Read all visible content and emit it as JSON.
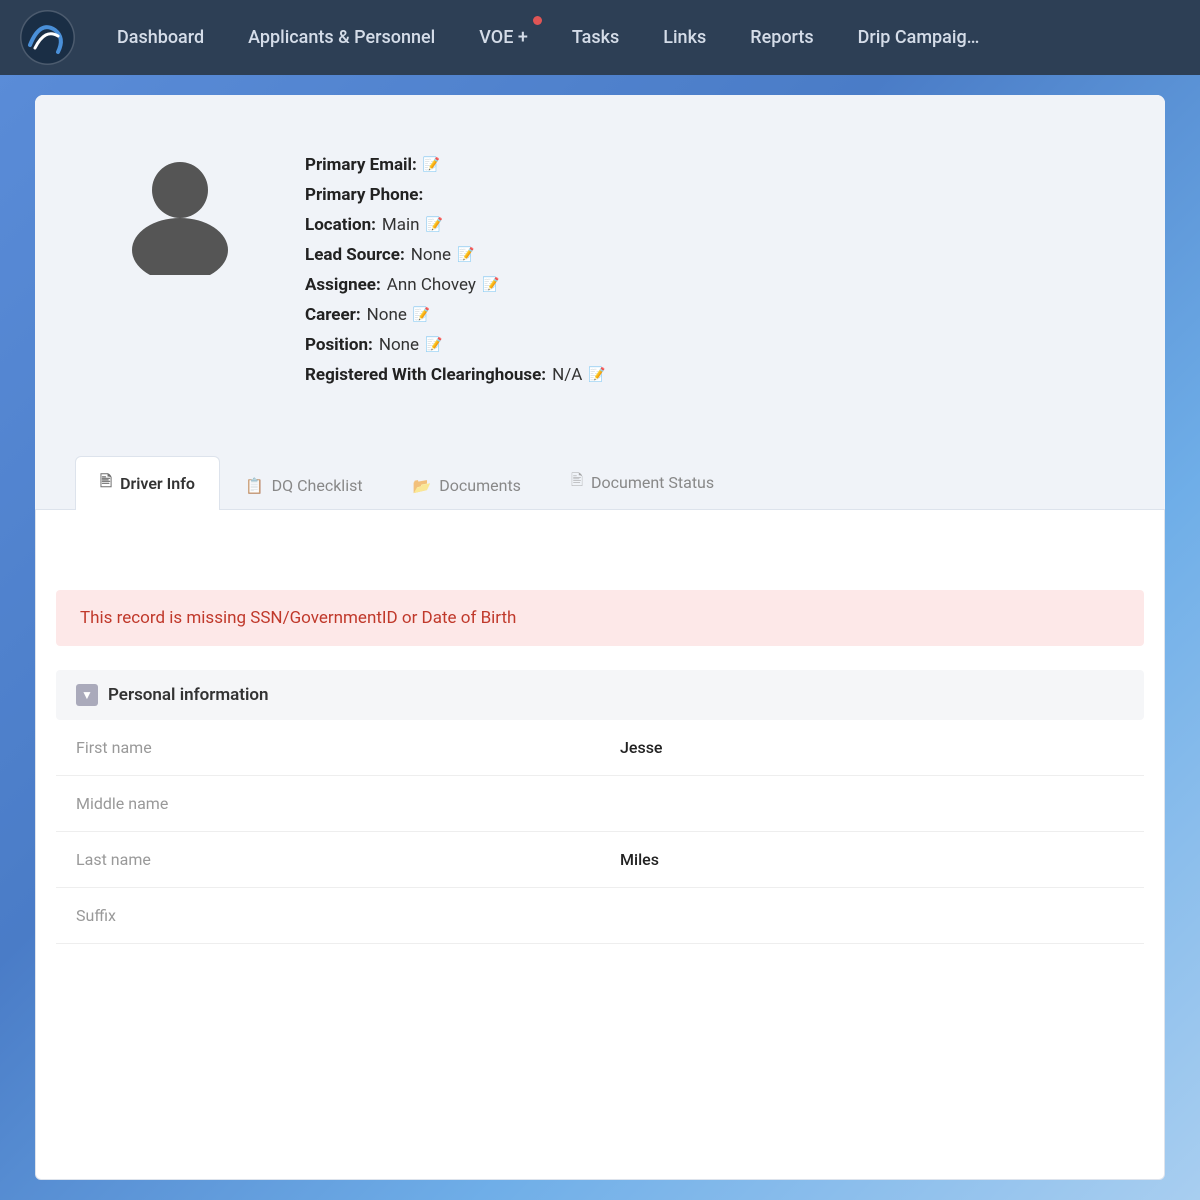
{
  "navbar": {
    "logo_alt": "App Logo",
    "items": [
      {
        "id": "dashboard",
        "label": "Dashboard",
        "has_dot": false
      },
      {
        "id": "applicants-personnel",
        "label": "Applicants & Personnel",
        "has_dot": false
      },
      {
        "id": "voe",
        "label": "VOE +",
        "has_dot": true
      },
      {
        "id": "tasks",
        "label": "Tasks",
        "has_dot": false
      },
      {
        "id": "links",
        "label": "Links",
        "has_dot": false
      },
      {
        "id": "reports",
        "label": "Reports",
        "has_dot": false
      },
      {
        "id": "drip-campaign",
        "label": "Drip Campaig…",
        "has_dot": false
      }
    ]
  },
  "profile": {
    "primary_email_label": "Primary Email:",
    "primary_phone_label": "Primary Phone:",
    "location_label": "Location:",
    "location_value": "Main",
    "lead_source_label": "Lead Source:",
    "lead_source_value": "None",
    "assignee_label": "Assignee:",
    "assignee_value": "Ann Chovey",
    "career_label": "Career:",
    "career_value": "None",
    "position_label": "Position:",
    "position_value": "None",
    "clearinghouse_label": "Registered With Clearinghouse:",
    "clearinghouse_value": "N/A"
  },
  "tabs": [
    {
      "id": "driver-info",
      "label": "Driver Info",
      "icon": "📄",
      "active": true
    },
    {
      "id": "dq-checklist",
      "label": "DQ Checklist",
      "icon": "📋",
      "active": false
    },
    {
      "id": "documents",
      "label": "Documents",
      "icon": "📁",
      "active": false
    },
    {
      "id": "document-status",
      "label": "Document Status",
      "icon": "📄",
      "active": false
    }
  ],
  "alert": {
    "message": "This record is missing SSN/GovernmentID or Date of Birth"
  },
  "personal_info": {
    "section_title": "Personal information",
    "toggle_icon": "▼",
    "fields": [
      {
        "label": "First name",
        "value": "Jesse"
      },
      {
        "label": "Middle name",
        "value": ""
      },
      {
        "label": "Last name",
        "value": "Miles"
      },
      {
        "label": "Suffix",
        "value": ""
      }
    ]
  },
  "colors": {
    "nav_bg": "#2d3f55",
    "accent_blue": "#4a90d9",
    "alert_bg": "#fde8e8",
    "alert_text": "#c0392b"
  }
}
